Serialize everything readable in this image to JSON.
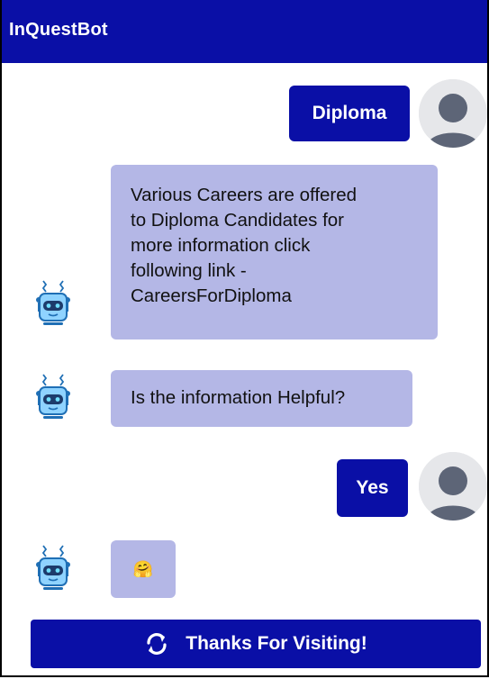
{
  "header": {
    "title": "InQuestBot"
  },
  "messages": {
    "user1": "Diploma",
    "bot1": [
      "Various Careers are offered",
      "to Diploma Candidates for",
      "more information click",
      "following link -",
      "CareersForDiploma"
    ],
    "bot2": "Is the information Helpful?",
    "user2": "Yes",
    "bot3_emoji": "🤗"
  },
  "footer": {
    "button_label": "Thanks For Visiting!"
  },
  "colors": {
    "primary": "#0a0fa6",
    "bot_bubble": "#b4b7e6",
    "avatar_bg": "#e6e7ea"
  }
}
